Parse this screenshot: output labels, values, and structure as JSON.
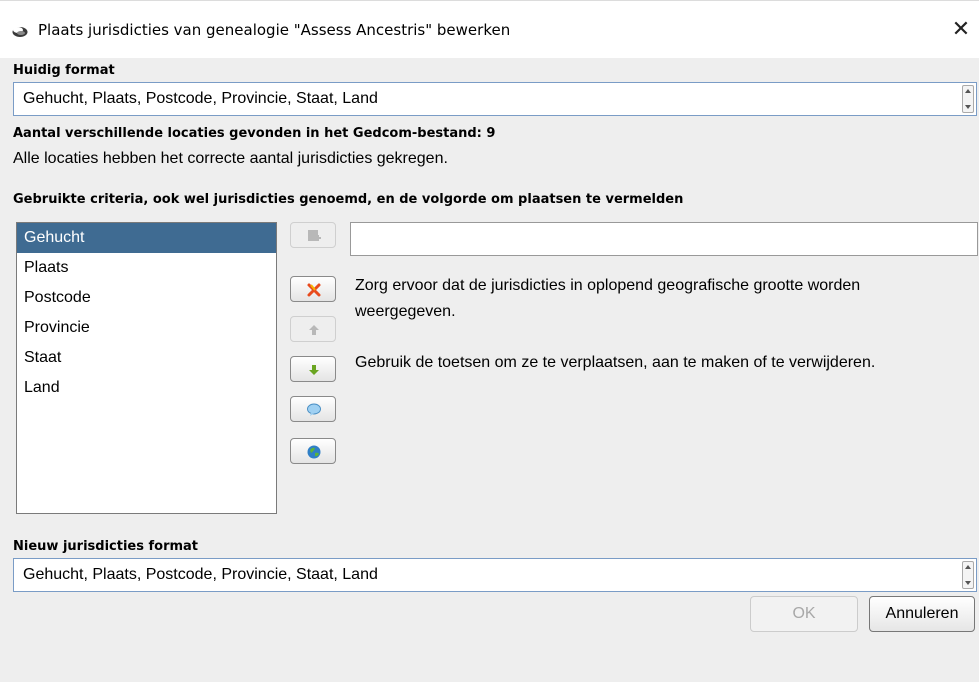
{
  "window": {
    "title": "Plaats jurisdicties van genealogie \"Assess Ancestris\" bewerken",
    "close_glyph": "✕"
  },
  "current_format": {
    "label": "Huidig format",
    "value": "Gehucht, Plaats, Postcode, Provincie, Staat, Land"
  },
  "status": {
    "count_label": "Aantal verschillende locaties gevonden in het Gedcom-bestand: 9",
    "message": "Alle locaties hebben het correcte aantal jurisdicties gekregen."
  },
  "criteria": {
    "label": "Gebruikte criteria, ook wel jurisdicties genoemd, en de volgorde om plaatsen te vermelden",
    "items": [
      "Gehucht",
      "Plaats",
      "Postcode",
      "Provincie",
      "Staat",
      "Land"
    ],
    "selected": "Gehucht",
    "edit_value": ""
  },
  "help": {
    "line1": "Zorg ervoor dat de jurisdicties in oplopend geografische grootte worden",
    "line2": "weergegeven.",
    "line3": "Gebruik de toetsen om ze te verplaatsen, aan te maken of te verwijderen."
  },
  "icons": {
    "app": "ancestris-logo-icon",
    "add": "add-icon",
    "delete": "delete-icon",
    "up": "arrow-up-icon",
    "down": "arrow-down-icon",
    "info": "speech-bubble-icon",
    "globe": "globe-icon",
    "accent_red": "#e84a1c",
    "accent_green": "#6aa521"
  },
  "new_format": {
    "label": "Nieuw jurisdicties format",
    "value": "Gehucht, Plaats, Postcode, Provincie, Staat, Land"
  },
  "buttons": {
    "ok": "OK",
    "cancel": "Annuleren"
  }
}
